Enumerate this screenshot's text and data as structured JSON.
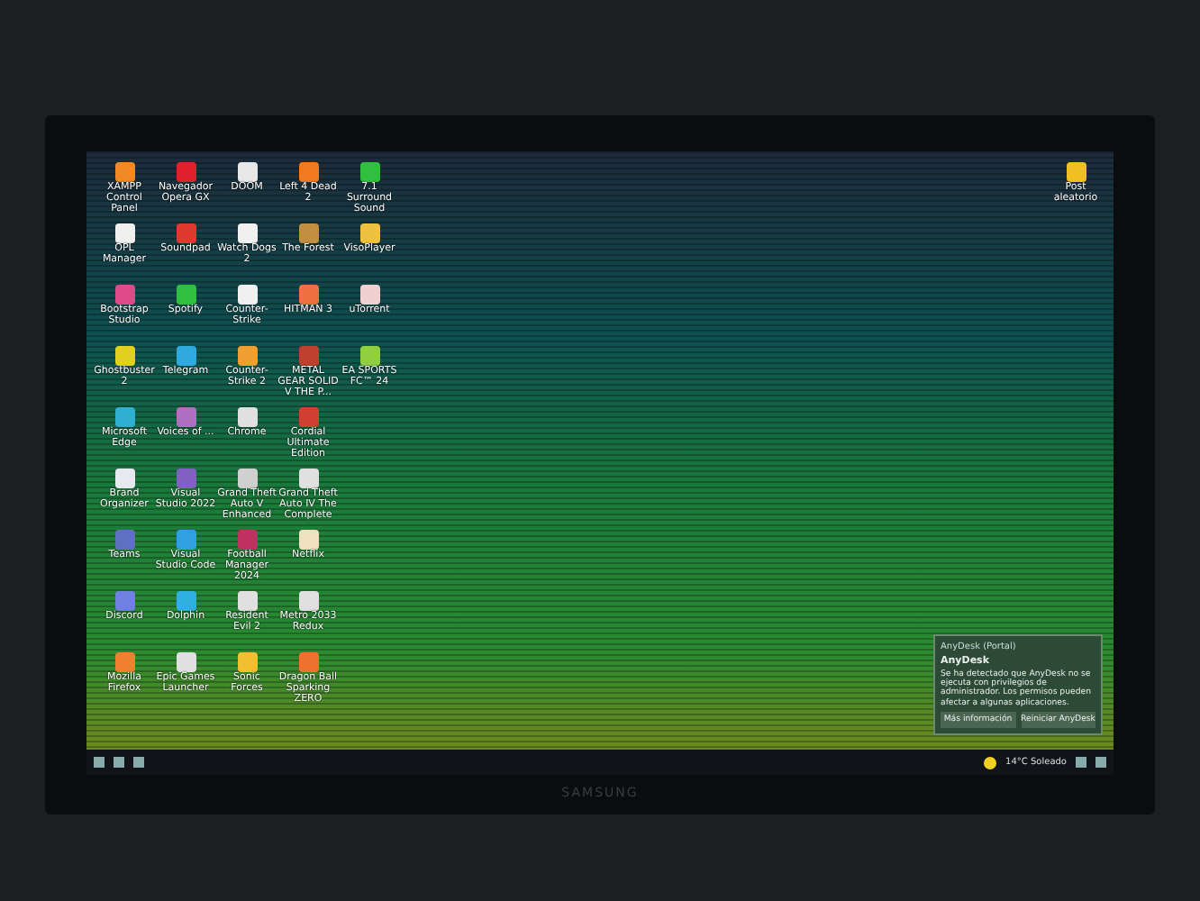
{
  "desktop": {
    "icon_rows": [
      [
        {
          "label": "XAMPP Control Panel",
          "color": "#f08a24"
        },
        {
          "label": "Navegador Opera GX",
          "color": "#e0202a"
        },
        {
          "label": "DOOM",
          "color": "#e8e8e8"
        },
        {
          "label": "Left 4 Dead 2",
          "color": "#f07a20"
        },
        {
          "label": "7.1 Surround Sound",
          "color": "#30c040"
        }
      ],
      [
        {
          "label": "OPL Manager",
          "color": "#f0f0f0"
        },
        {
          "label": "Soundpad",
          "color": "#e03a30"
        },
        {
          "label": "Watch Dogs 2",
          "color": "#f0f0f0"
        },
        {
          "label": "The Forest",
          "color": "#c09040"
        },
        {
          "label": "VisoPlayer",
          "color": "#f0c040"
        }
      ],
      [
        {
          "label": "Bootstrap Studio",
          "color": "#e04a8a"
        },
        {
          "label": "Spotify",
          "color": "#30c040"
        },
        {
          "label": "Counter-Strike",
          "color": "#f0f0f0"
        },
        {
          "label": "HITMAN 3",
          "color": "#f07040"
        },
        {
          "label": "uTorrent",
          "color": "#f0d0d0"
        }
      ],
      [
        {
          "label": "Ghostbuster 2",
          "color": "#e0d020"
        },
        {
          "label": "Telegram",
          "color": "#30a8e0"
        },
        {
          "label": "Counter-Strike 2",
          "color": "#f0a030"
        },
        {
          "label": "METAL GEAR SOLID V THE P...",
          "color": "#c04030"
        },
        {
          "label": "EA SPORTS FC™ 24",
          "color": "#90d040"
        }
      ],
      [
        {
          "label": "Microsoft Edge",
          "color": "#30b0d0"
        },
        {
          "label": "Voices of ...",
          "color": "#b070c0"
        },
        {
          "label": "Chrome",
          "color": "#e0e0e0"
        },
        {
          "label": "Cordial Ultimate Edition",
          "color": "#d04030"
        }
      ],
      [
        {
          "label": "Brand Organizer",
          "color": "#e8e8f0"
        },
        {
          "label": "Visual Studio 2022",
          "color": "#8060c0"
        },
        {
          "label": "Grand Theft Auto V Enhanced",
          "color": "#d0d0d0"
        },
        {
          "label": "Grand Theft Auto IV The Complete",
          "color": "#e0e0e0"
        }
      ],
      [
        {
          "label": "Teams",
          "color": "#6070c0"
        },
        {
          "label": "Visual Studio Code",
          "color": "#30a0e0"
        },
        {
          "label": "Football Manager 2024",
          "color": "#c03060"
        },
        {
          "label": "Netflix",
          "color": "#f0e0c0"
        }
      ],
      [
        {
          "label": "Discord",
          "color": "#7080e0"
        },
        {
          "label": "Dolphin",
          "color": "#30b0e0"
        },
        {
          "label": "Resident Evil 2",
          "color": "#e0e0e0"
        },
        {
          "label": "Metro 2033 Redux",
          "color": "#e0e0e0"
        }
      ],
      [
        {
          "label": "Mozilla Firefox",
          "color": "#f08030"
        },
        {
          "label": "Epic Games Launcher",
          "color": "#e0e0e0"
        },
        {
          "label": "Sonic Forces",
          "color": "#f0c030"
        },
        {
          "label": "Dragon Ball Sparking ZERO",
          "color": "#f07030"
        }
      ]
    ],
    "right_icon": {
      "label": "Post aleatorio",
      "color": "#f0c020"
    }
  },
  "notification": {
    "title": "AnyDesk (Portal)",
    "heading": "AnyDesk",
    "body": "Se ha detectado que AnyDesk no se ejecuta con privilegios de administrador. Los permisos pueden afectar a algunas aplicaciones.",
    "buttons": [
      "Más información",
      "Reiniciar AnyDesk"
    ]
  },
  "taskbar": {
    "weather": "14°C Soleado"
  },
  "monitor": {
    "brand": "SAMSUNG"
  }
}
